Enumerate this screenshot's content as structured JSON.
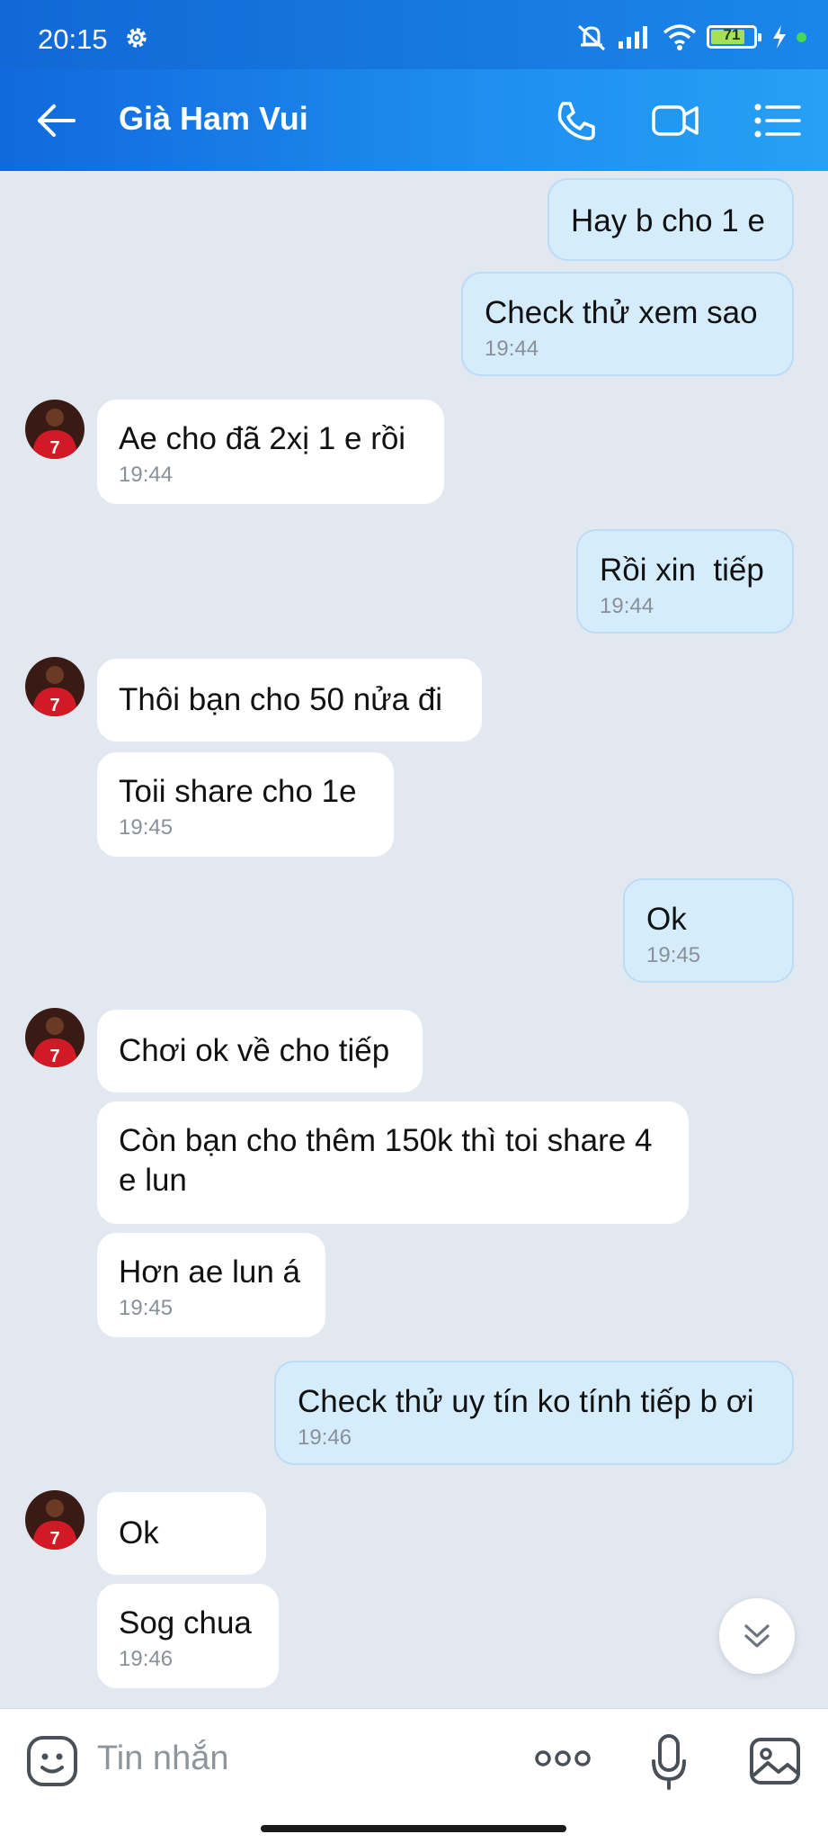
{
  "status_bar": {
    "time": "20:15",
    "battery": "71",
    "icons": [
      "gear-icon",
      "mute-icon",
      "signal-icon",
      "wifi-icon",
      "battery-icon",
      "charging-icon"
    ]
  },
  "header": {
    "contact_name": "Già Ham Vui",
    "icons": [
      "back-arrow-icon",
      "phone-icon",
      "video-icon",
      "menu-icon"
    ]
  },
  "messages": [
    {
      "dir": "out",
      "text": "Hay b cho 1 e",
      "time": ""
    },
    {
      "dir": "out",
      "text": "Check thử xem sao",
      "time": "19:44"
    },
    {
      "dir": "in",
      "text": "Ae cho đã 2xị 1 e rồi",
      "time": "19:44",
      "avatar": true
    },
    {
      "dir": "out",
      "text": "Rồi xin  tiếp",
      "time": "19:44"
    },
    {
      "dir": "in",
      "text": "Thôi bạn cho 50 nửa đi",
      "time": "",
      "avatar": true
    },
    {
      "dir": "in",
      "text": "Toii share cho 1e",
      "time": "19:45"
    },
    {
      "dir": "out",
      "text": "Ok",
      "time": "19:45"
    },
    {
      "dir": "in",
      "text": "Chơi ok về cho tiếp",
      "time": "",
      "avatar": true
    },
    {
      "dir": "in",
      "text": "Còn bạn cho thêm 150k thì toi share 4 e lun",
      "time": ""
    },
    {
      "dir": "in",
      "text": "Hơn ae lun á",
      "time": "19:45"
    },
    {
      "dir": "out",
      "text": "Check thử uy tín ko tính tiếp b ơi",
      "time": "19:46"
    },
    {
      "dir": "in",
      "text": "Ok",
      "time": "",
      "avatar": true
    },
    {
      "dir": "in",
      "text": "Sog chua",
      "time": "19:46"
    }
  ],
  "input_bar": {
    "placeholder": "Tin nhắn",
    "icons": [
      "emoji-icon",
      "more-icon",
      "mic-icon",
      "image-icon"
    ]
  },
  "colors": {
    "header_blue": "#1a86ea",
    "outgoing_bubble": "#d5ecfc",
    "incoming_bubble": "#ffffff",
    "chat_background": "#e2e8f0"
  }
}
